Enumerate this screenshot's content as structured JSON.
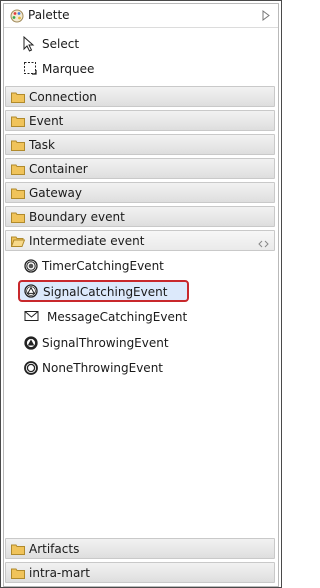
{
  "palette": {
    "title": "Palette",
    "tools": [
      {
        "label": "Select",
        "icon": "arrow-pointer-icon"
      },
      {
        "label": "Marquee",
        "icon": "marquee-icon"
      }
    ],
    "drawers": [
      {
        "label": "Connection"
      },
      {
        "label": "Event"
      },
      {
        "label": "Task"
      },
      {
        "label": "Container"
      },
      {
        "label": "Gateway"
      },
      {
        "label": "Boundary event"
      },
      {
        "label": "Intermediate event",
        "expanded": true
      }
    ],
    "intermediate_events": [
      {
        "label": "TimerCatchingEvent",
        "icon": "timer-event-icon"
      },
      {
        "label": "SignalCatchingEvent",
        "icon": "signal-catching-icon",
        "selected": true
      },
      {
        "label": "MessageCatchingEvent",
        "icon": "envelope-icon"
      },
      {
        "label": "SignalThrowingEvent",
        "icon": "signal-throwing-icon"
      },
      {
        "label": "NoneThrowingEvent",
        "icon": "none-throwing-icon"
      }
    ],
    "bottom_drawers": [
      {
        "label": "Artifacts"
      },
      {
        "label": "intra-mart"
      }
    ]
  },
  "colors": {
    "selection_border": "#c8282c",
    "selection_fill": "#dce9fb",
    "folder": "#f0c35a"
  }
}
